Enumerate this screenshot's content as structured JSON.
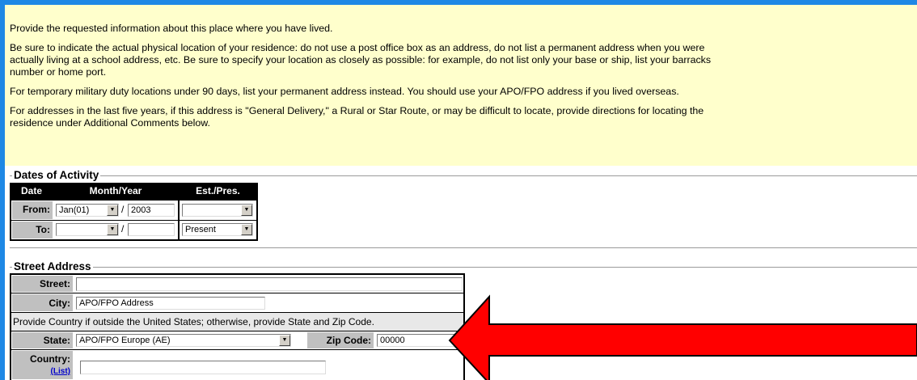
{
  "instructions": {
    "p1": "Provide the requested information about this place where you have lived.",
    "p2_line1": "Be sure to indicate the actual physical location of your residence: do not use a post office box as an address, do not list a permanent address when you were",
    "p2_line2": "actually living at a school address, etc. Be sure to specify your location as closely as possible: for example, do not list only your base or ship, list your barracks",
    "p2_line3": "number or home port.",
    "p3": "For temporary military duty locations under 90 days, list your permanent address instead. You should use your APO/FPO address if you lived overseas.",
    "p4_line1": "For addresses in the last five years, if this address is \"General Delivery,\" a Rural or Star Route, or may be difficult to locate, provide directions for locating the",
    "p4_line2": "residence under Additional Comments below."
  },
  "dates": {
    "legend": "Dates of Activity",
    "headers": [
      "Date",
      "Month/Year",
      "Est./Pres."
    ],
    "from_label": "From:",
    "to_label": "To:",
    "from_month": "Jan(01)",
    "from_year": "2003",
    "from_est": "",
    "to_month": "",
    "to_year": "",
    "to_est": "Present",
    "slash": "/"
  },
  "address": {
    "legend": "Street Address",
    "street_label": "Street:",
    "street_value": "",
    "city_label": "City:",
    "city_value": "APO/FPO Address",
    "note": "Provide Country if outside the United States; otherwise, provide State and Zip Code.",
    "state_label": "State:",
    "state_value": "APO/FPO Europe (AE)",
    "zip_label": "Zip Code:",
    "zip_value": "00000",
    "country_label": "Country:",
    "country_link": "(List)",
    "country_value": ""
  },
  "colors": {
    "instruction_bg": "#ffffcc",
    "frame": "#1e88e5",
    "arrow": "#ff0000",
    "link": "#0000cc"
  },
  "icons": {
    "dropdown": "triangle-down",
    "arrow": "red-left-arrow"
  }
}
